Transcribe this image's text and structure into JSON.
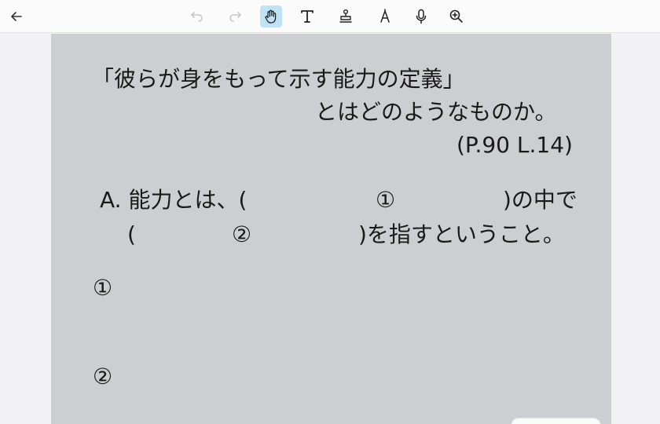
{
  "toolbar": {
    "back": "back-arrow",
    "undo": "undo",
    "redo": "redo",
    "hand": "hand",
    "text": "text",
    "stamp": "stamp",
    "pen": "pen",
    "mic": "mic",
    "zoom": "zoom-in",
    "active_tool": "hand",
    "active_color": "#bfe3f5"
  },
  "page": {
    "question_line1": "「彼らが身をもって示す能力の定義」",
    "question_line2": "とはどのようなものか。",
    "reference": "(P.90 L.14)",
    "answer_prefix": "A. 能力とは、(",
    "blank1_marker": "①",
    "answer_line1_end": ")の中で",
    "answer_line2_start": "(",
    "blank2_marker": "②",
    "answer_line2_end": ")を指すということ。",
    "item1_marker": "①",
    "item2_marker": "②"
  }
}
